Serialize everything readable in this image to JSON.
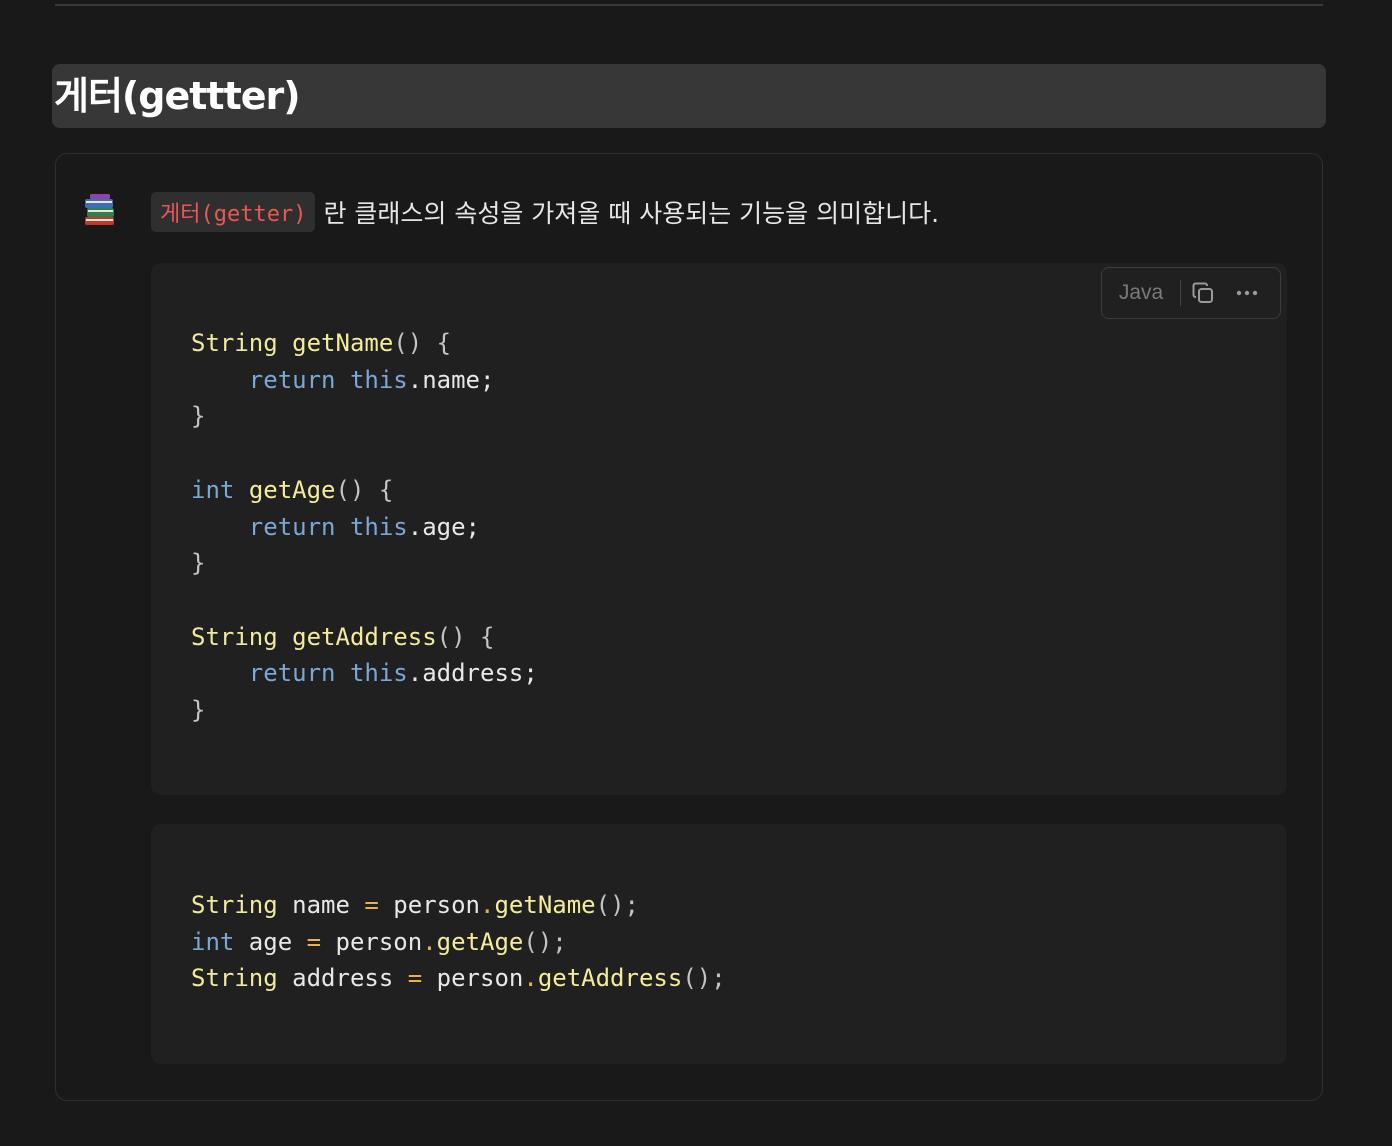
{
  "heading": {
    "title": "게터(gettter)"
  },
  "callout": {
    "icon": "books-icon",
    "inline_code": "게터(getter)",
    "text": "란 클래스의 속성을 가져올 때 사용되는 기능을 의미합니다."
  },
  "code_block_1": {
    "language": "Java",
    "copy_icon": "copy-icon",
    "more_icon": "more-icon"
  },
  "colors": {
    "background": "#191919",
    "heading_bg": "#373737",
    "code_bg": "#202020",
    "keyword": "#79a8d6",
    "type": "#f0e9a0",
    "function": "#f4ec9a",
    "inline_code": "#eb5757"
  }
}
